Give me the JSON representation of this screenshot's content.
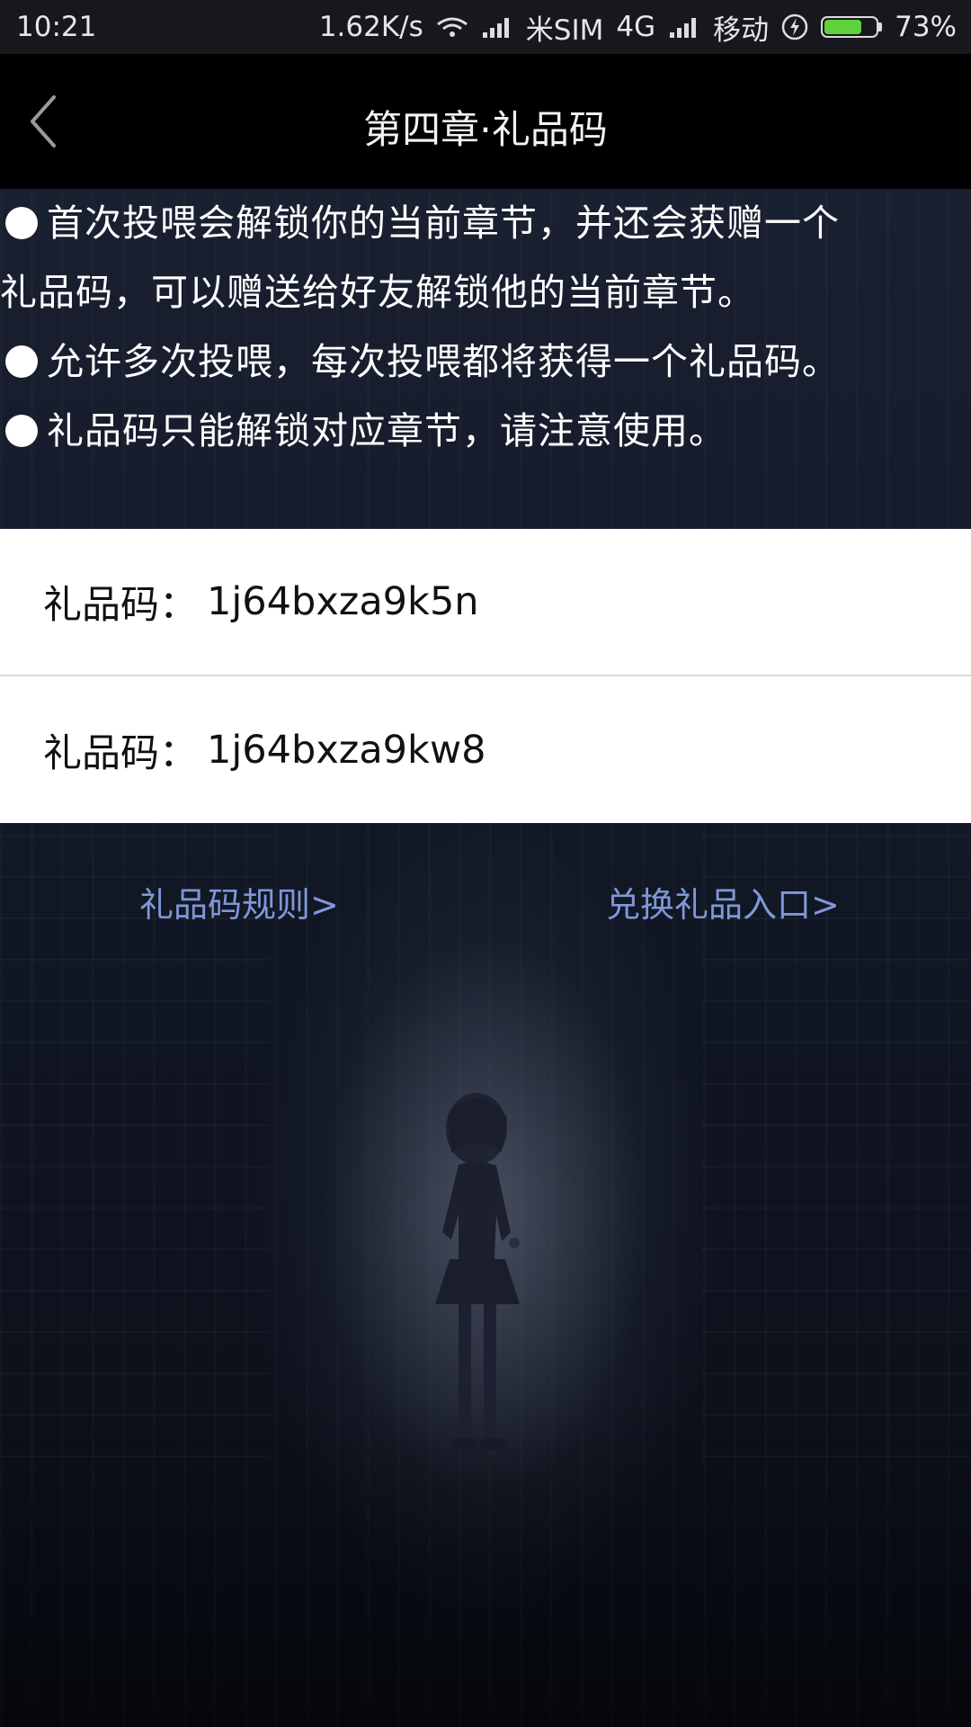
{
  "status_bar": {
    "time": "10:21",
    "speed": "1.62K/s",
    "carrier1": "米SIM",
    "network": "4G",
    "carrier2": "移动",
    "battery_level": 73,
    "battery": "73%",
    "battery_color": "#5fd13a"
  },
  "nav": {
    "title": "第四章·礼品码"
  },
  "rules": [
    "首次投喂会解锁你的当前章节，并还会获赠一个",
    "礼品码，可以赠送给好友解锁他的当前章节。",
    "允许多次投喂，每次投喂都将获得一个礼品码。",
    "礼品码只能解锁对应章节，请注意使用。"
  ],
  "codes": [
    {
      "label": "礼品码：",
      "value": "1j64bxza9k5n"
    },
    {
      "label": "礼品码：",
      "value": "1j64bxza9kw8"
    }
  ],
  "links": {
    "rules": "礼品码规则>",
    "redeem": "兑换礼品入口>",
    "color": "#7e98d6"
  },
  "icons": {
    "back": "back-arrow-icon",
    "wifi": "wifi-icon",
    "signal": "signal-icon",
    "charging": "charging-icon",
    "battery": "battery-icon"
  }
}
